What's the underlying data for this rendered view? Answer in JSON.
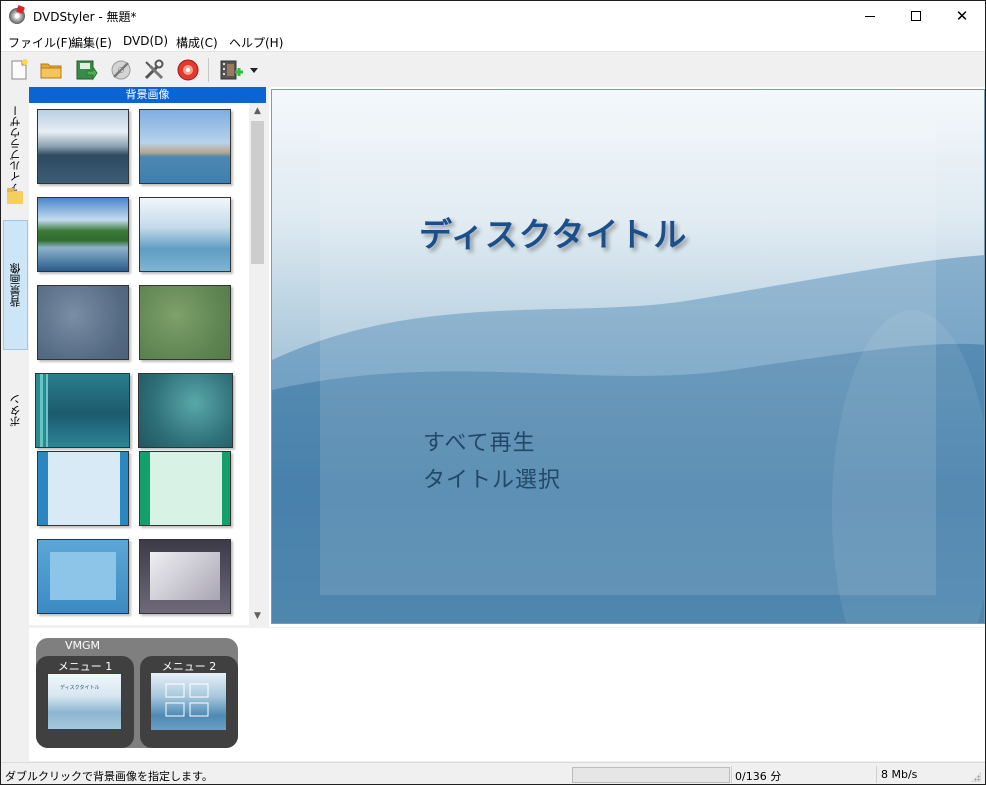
{
  "window": {
    "title": "DVDStyler - 無題*",
    "controls": [
      "minimize",
      "maximize",
      "close"
    ]
  },
  "menubar": {
    "items": [
      "ファイル(F)",
      "編集(E)",
      "DVD(D)",
      "構成(C)",
      "ヘルプ(H)"
    ]
  },
  "toolbar": {
    "buttons": [
      {
        "name": "new-icon"
      },
      {
        "name": "open-folder-icon"
      },
      {
        "name": "save-icon"
      },
      {
        "name": "burn-icon"
      },
      {
        "name": "settings-icon"
      },
      {
        "name": "disc-icon"
      },
      {
        "name": "add-video-icon"
      },
      {
        "name": "dropdown-arrow-icon"
      }
    ]
  },
  "sidebar": {
    "tabs": [
      {
        "label": "ファイルブラウザー",
        "active": false
      },
      {
        "label": "背景画像",
        "active": true
      },
      {
        "label": "ボタン",
        "active": false
      }
    ],
    "panel_title": "背景画像",
    "thumbnails": [
      "ocean-bay",
      "harbor-boat",
      "lake-shore",
      "blue-wave",
      "gray-clouds",
      "green-texture",
      "teal-stripes",
      "teal-texture",
      "blue-frame",
      "green-frame",
      "blue-box",
      "gray-box"
    ]
  },
  "preview": {
    "title": "ディスクタイトル",
    "buttons": [
      "すべて再生",
      "タイトル選択"
    ]
  },
  "menus": {
    "group_label": "VMGM",
    "items": [
      "メニュー 1",
      "メニュー 2"
    ],
    "thumb_caption": "ディスクタイトル"
  },
  "statusbar": {
    "message": "ダブルクリックで背景画像を指定します。",
    "duration": "0/136 分",
    "bitrate": "8 Mb/s"
  }
}
